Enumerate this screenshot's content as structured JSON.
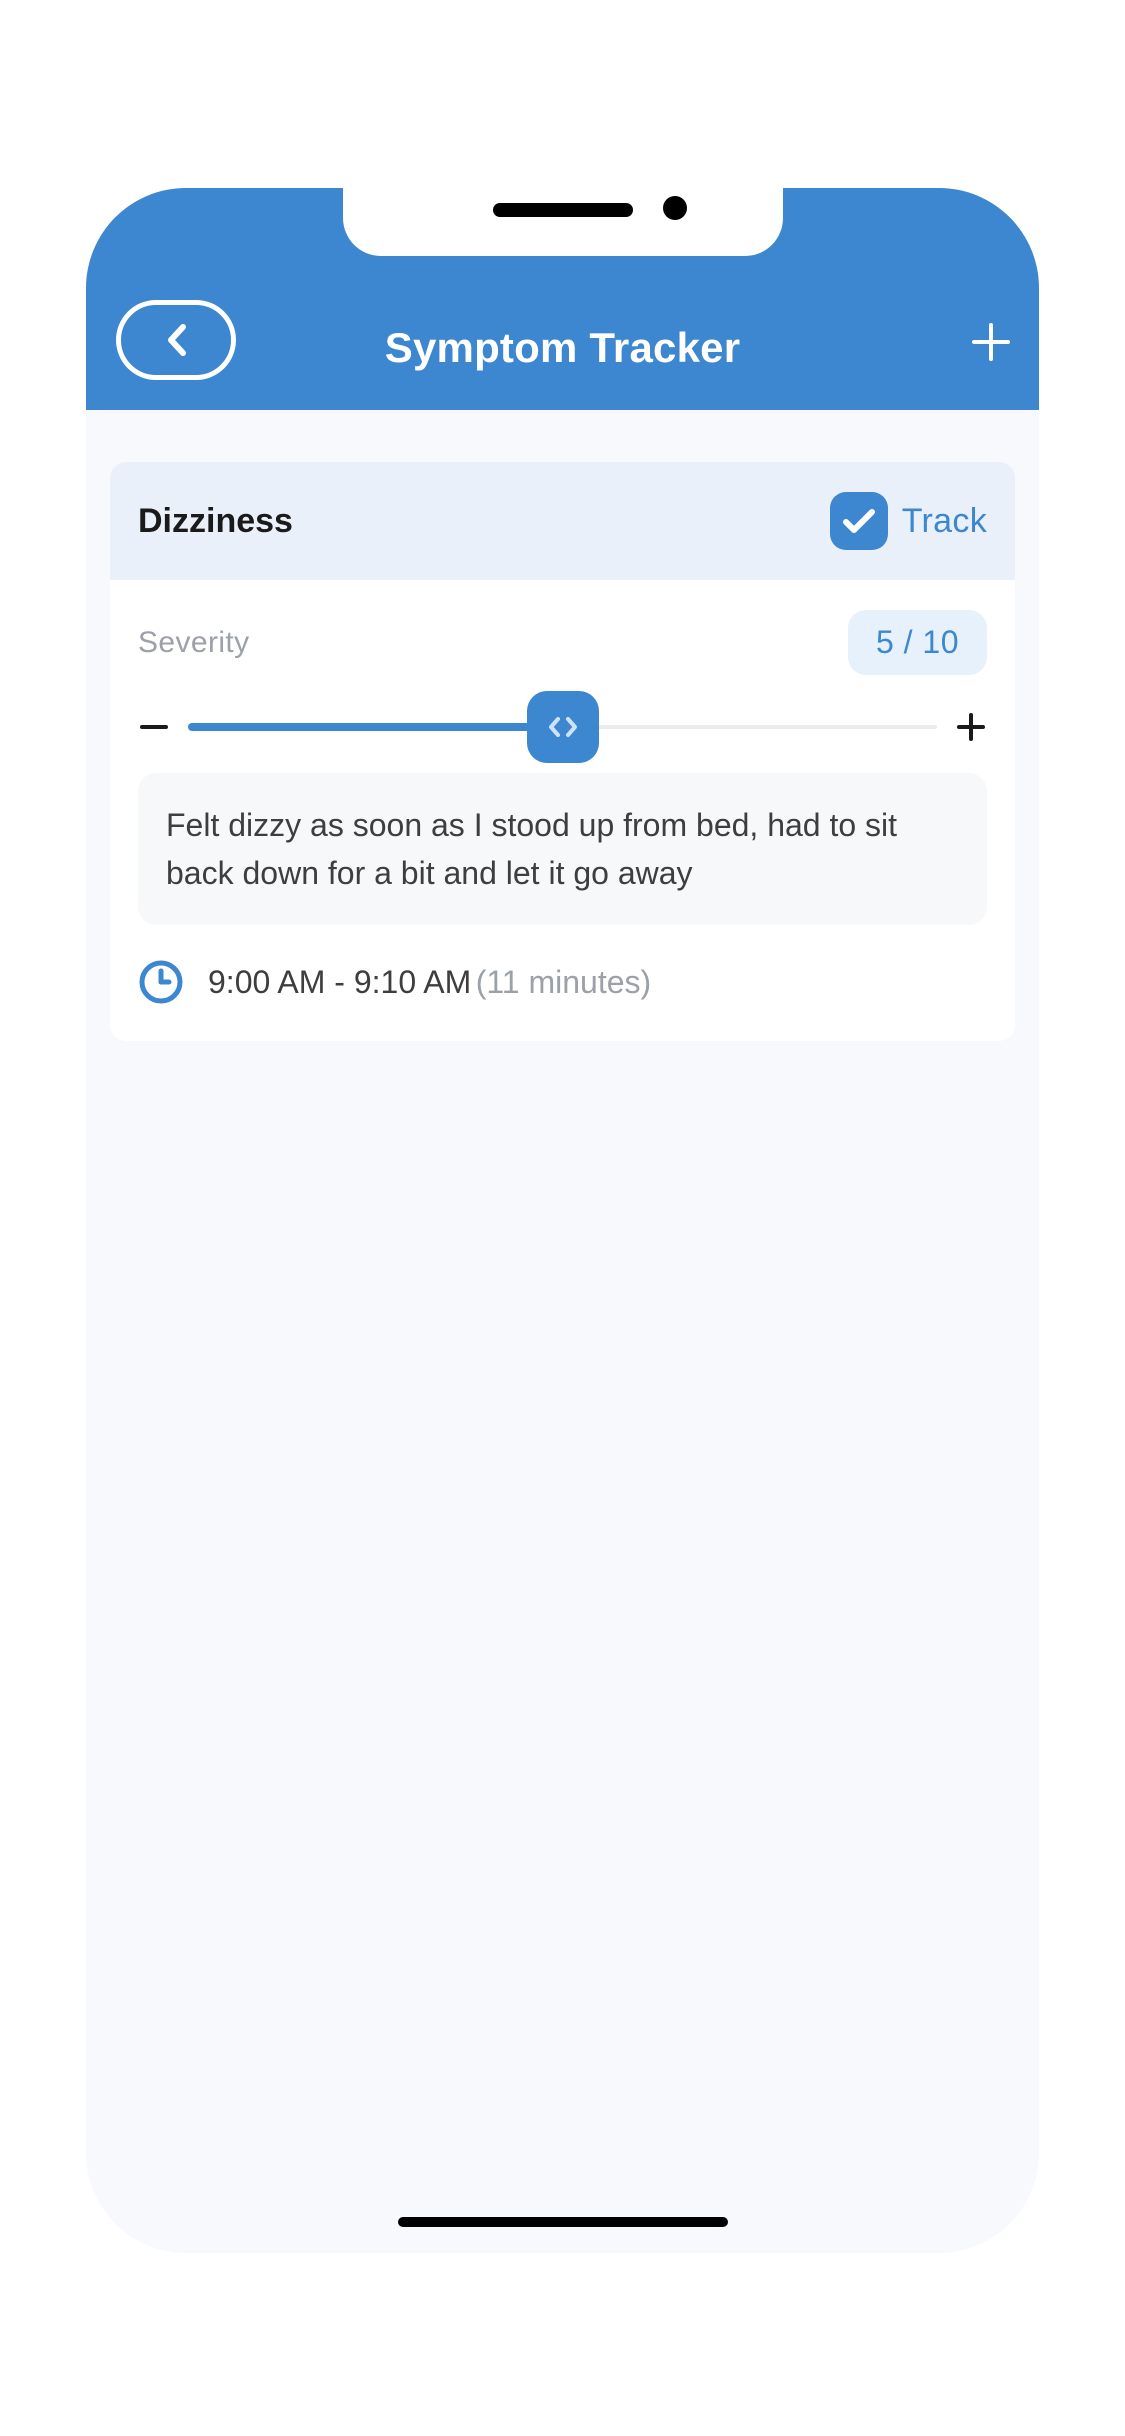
{
  "header": {
    "title": "Symptom Tracker"
  },
  "symptom": {
    "name": "Dizziness",
    "track_label": "Track",
    "severity_label": "Severity",
    "severity_display": "5 / 10",
    "severity_value": 5,
    "severity_max": 10,
    "notes": "Felt dizzy as soon as I stood up from bed, had to sit back down for a bit and let it go away",
    "time_range": "9:00 AM - 9:10 AM",
    "time_duration": "(11 minutes)"
  }
}
